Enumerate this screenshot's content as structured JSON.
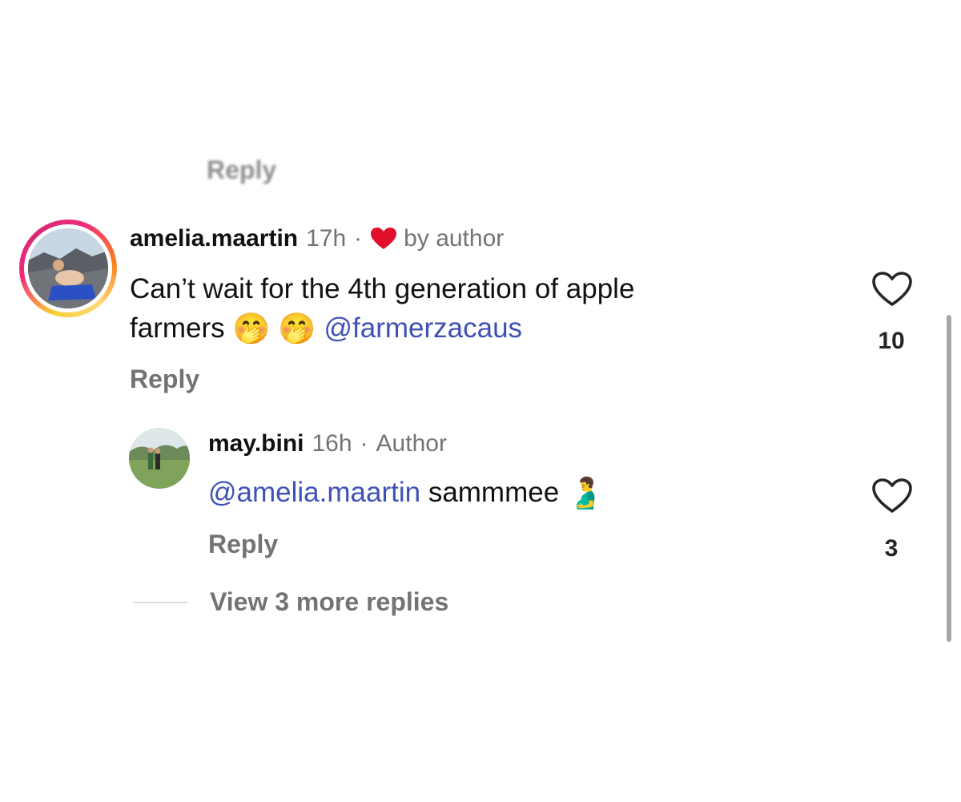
{
  "top_reply": {
    "label": "Reply"
  },
  "comment": {
    "username": "amelia.maartin",
    "time": "17h",
    "separator": "·",
    "liked_by": "by author",
    "text_line1": "Can’t wait for the 4th generation of apple",
    "text_line2": "farmers",
    "emoji_1": "🤭",
    "emoji_2": "🤭",
    "mention": "@farmerzacaus",
    "reply_label": "Reply",
    "like_count": "10",
    "like_icon": "heart-outline-icon",
    "liked_by_icon": "red-heart-icon"
  },
  "reply": {
    "username": "may.bini",
    "time": "16h",
    "separator": "·",
    "role": "Author",
    "mention": "@amelia.maartin",
    "text": "sammmee",
    "emoji": "🫃",
    "reply_label": "Reply",
    "like_count": "3",
    "like_icon": "heart-outline-icon"
  },
  "view_more": {
    "label": "View 3 more replies"
  },
  "colors": {
    "mention": "#3f51b5",
    "secondary_text": "#737373",
    "liked_heart": "#e0102c",
    "primary_text": "#111111"
  }
}
